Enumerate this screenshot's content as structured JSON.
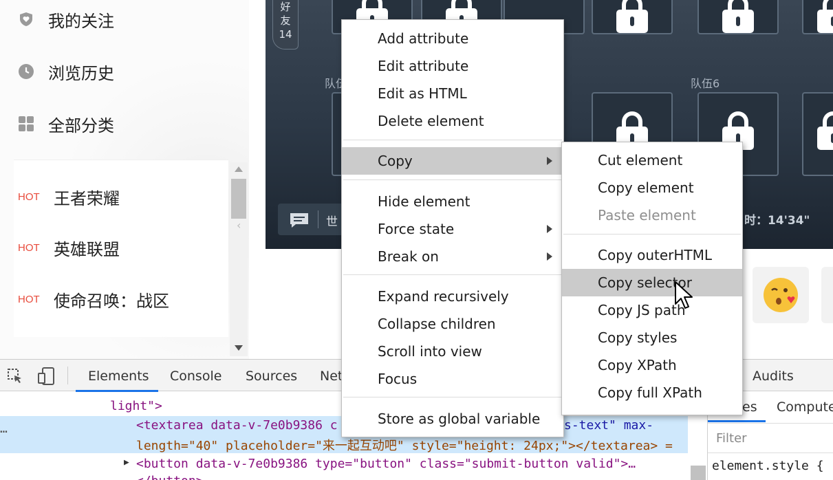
{
  "sidebar": {
    "nav": [
      {
        "label": "我的关注",
        "icon": "heart-shield-icon"
      },
      {
        "label": "浏览历史",
        "icon": "clock-icon"
      },
      {
        "label": "全部分类",
        "icon": "grid-icon"
      }
    ],
    "hot": [
      {
        "badge": "HOT",
        "title": "王者荣耀"
      },
      {
        "badge": "HOT",
        "title": "英雄联盟"
      },
      {
        "badge": "HOT",
        "title": "使命召唤：战区"
      }
    ]
  },
  "game": {
    "friend_tab": [
      "好",
      "友",
      "14"
    ],
    "team_labels": [
      "队伍",
      "队伍6"
    ],
    "chat_text": "世",
    "timer": "时：14'34\""
  },
  "devtools": {
    "tabs": [
      "Elements",
      "Console",
      "Sources",
      "Net",
      "Audits"
    ],
    "side_tabs": [
      "Styles",
      "Compute"
    ],
    "filter_placeholder": "Filter",
    "element_style": "element.style {",
    "code_lines": {
      "l1": "light\">",
      "l2a": "<textarea data-v-7e0b9386 c",
      "l2b": "s-text\" max-",
      "l3": "length=\"40\" placeholder=\"来一起互动吧\" style=\"height: 24px;\"></textarea> =",
      "l4": "<button data-v-7e0b9386 type=\"button\" class=\"submit-button valid\">…",
      "l5": "</button>"
    }
  },
  "context_menu": {
    "items": [
      "Add attribute",
      "Edit attribute",
      "Edit as HTML",
      "Delete element",
      "Copy",
      "Hide element",
      "Force state",
      "Break on",
      "Expand recursively",
      "Collapse children",
      "Scroll into view",
      "Focus",
      "Store as global variable"
    ]
  },
  "copy_submenu": {
    "items": [
      "Cut element",
      "Copy element",
      "Paste element",
      "Copy outerHTML",
      "Copy selector",
      "Copy JS path",
      "Copy styles",
      "Copy XPath",
      "Copy full XPath"
    ],
    "highlighted": "Copy selector",
    "disabled": "Paste element"
  },
  "colors": {
    "hot": "#e84a3b",
    "menu_highlight": "#cbcbcb",
    "selected_line": "#cfe8fc",
    "accent": "#1a73e8"
  }
}
